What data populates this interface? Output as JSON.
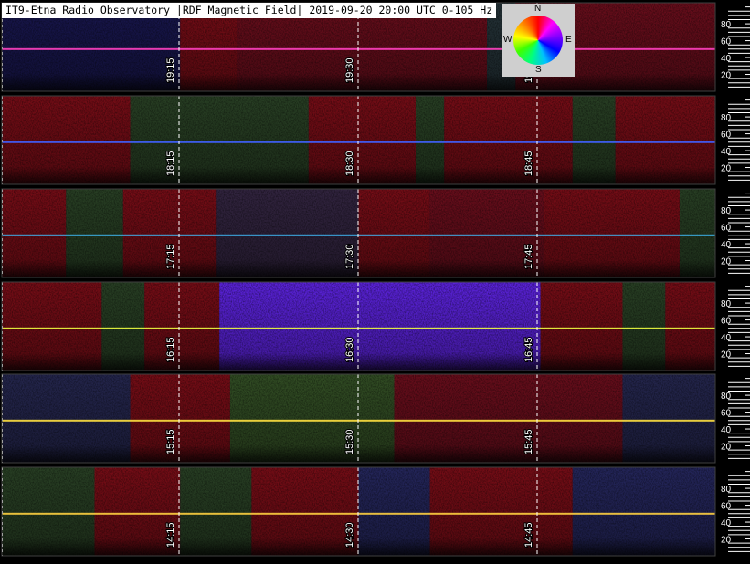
{
  "header": {
    "title": "IT9-Etna Radio Observatory |RDF Magnetic Field| 2019-09-20 20:00 UTC 0-105 Hz"
  },
  "compass": {
    "n": "N",
    "s": "S",
    "e": "E",
    "w": "W"
  },
  "chart_data": {
    "type": "heatmap",
    "title": "IT9-Etna Radio Observatory |RDF Magnetic Field| 2019-09-20 20:00 UTC 0-105 Hz",
    "y_range_hz": [
      0,
      105
    ],
    "y_ticks": [
      "20",
      "40",
      "60",
      "80"
    ],
    "panels": [
      {
        "time_labels": [
          "19:15",
          "19:30",
          "19:"
        ],
        "blocks": [
          {
            "t": [
              0.0,
              0.25
            ],
            "c": "#1c1a5a"
          },
          {
            "t": [
              0.25,
              0.33
            ],
            "c": "#8a0f1a"
          },
          {
            "t": [
              0.33,
              0.68
            ],
            "c": "#7a1020"
          },
          {
            "t": [
              0.68,
              0.72
            ],
            "c": "#2a3a40"
          },
          {
            "t": [
              0.72,
              1.0
            ],
            "c": "#7a1020"
          }
        ],
        "line": "#ff40c0"
      },
      {
        "time_labels": [
          "18:15",
          "18:30",
          "18:45"
        ],
        "blocks": [
          {
            "t": [
              0.0,
              0.18
            ],
            "c": "#8a0f1a"
          },
          {
            "t": [
              0.18,
              0.43
            ],
            "c": "#2f4a2a"
          },
          {
            "t": [
              0.43,
              0.58
            ],
            "c": "#8a0f1a"
          },
          {
            "t": [
              0.58,
              0.62
            ],
            "c": "#2f4a2a"
          },
          {
            "t": [
              0.62,
              0.8
            ],
            "c": "#8a0f1a"
          },
          {
            "t": [
              0.8,
              0.86
            ],
            "c": "#2f4a2a"
          },
          {
            "t": [
              0.86,
              1.0
            ],
            "c": "#8a0f1a"
          }
        ],
        "line": "#4060ff"
      },
      {
        "time_labels": [
          "17:15",
          "17:30",
          "17:45"
        ],
        "blocks": [
          {
            "t": [
              0.0,
              0.09
            ],
            "c": "#8a0f1a"
          },
          {
            "t": [
              0.09,
              0.17
            ],
            "c": "#2f4a2a"
          },
          {
            "t": [
              0.17,
              0.3
            ],
            "c": "#8a0f1a"
          },
          {
            "t": [
              0.3,
              0.5
            ],
            "c": "#3a2a4a"
          },
          {
            "t": [
              0.5,
              0.6
            ],
            "c": "#8a0f1a"
          },
          {
            "t": [
              0.6,
              0.76
            ],
            "c": "#7a1020"
          },
          {
            "t": [
              0.76,
              0.95
            ],
            "c": "#8a0f1a"
          },
          {
            "t": [
              0.95,
              1.0
            ],
            "c": "#2f4a2a"
          }
        ],
        "line": "#40c0ff"
      },
      {
        "time_labels": [
          "16:15",
          "16:30",
          "16:45"
        ],
        "blocks": [
          {
            "t": [
              0.0,
              0.14
            ],
            "c": "#8a0f1a"
          },
          {
            "t": [
              0.14,
              0.2
            ],
            "c": "#2f4a2a"
          },
          {
            "t": [
              0.2,
              0.305
            ],
            "c": "#8a0f1a"
          },
          {
            "t": [
              0.305,
              0.755
            ],
            "c": "#6a28ff"
          },
          {
            "t": [
              0.755,
              0.87
            ],
            "c": "#8a0f1a"
          },
          {
            "t": [
              0.87,
              0.93
            ],
            "c": "#2f4a2a"
          },
          {
            "t": [
              0.93,
              1.0
            ],
            "c": "#8a0f1a"
          }
        ],
        "line": "#f0ff40"
      },
      {
        "time_labels": [
          "15:15",
          "15:30",
          "15:45"
        ],
        "blocks": [
          {
            "t": [
              0.0,
              0.18
            ],
            "c": "#2a2c5a"
          },
          {
            "t": [
              0.18,
              0.32
            ],
            "c": "#8a0f1a"
          },
          {
            "t": [
              0.32,
              0.55
            ],
            "c": "#3a5a2a"
          },
          {
            "t": [
              0.55,
              0.87
            ],
            "c": "#7a1020"
          },
          {
            "t": [
              0.87,
              1.0
            ],
            "c": "#2a2c5a"
          }
        ],
        "line": "#ffe040"
      },
      {
        "time_labels": [
          "14:15",
          "14:30",
          "14:45"
        ],
        "blocks": [
          {
            "t": [
              0.0,
              0.13
            ],
            "c": "#2f4a2a"
          },
          {
            "t": [
              0.13,
              0.25
            ],
            "c": "#8a0f1a"
          },
          {
            "t": [
              0.25,
              0.35
            ],
            "c": "#2f4a2a"
          },
          {
            "t": [
              0.35,
              0.5
            ],
            "c": "#8a0f1a"
          },
          {
            "t": [
              0.5,
              0.6
            ],
            "c": "#2a2c6a"
          },
          {
            "t": [
              0.6,
              0.8
            ],
            "c": "#8a0f1a"
          },
          {
            "t": [
              0.8,
              1.0
            ],
            "c": "#2a2c6a"
          }
        ],
        "line": "#ffd040"
      }
    ]
  }
}
